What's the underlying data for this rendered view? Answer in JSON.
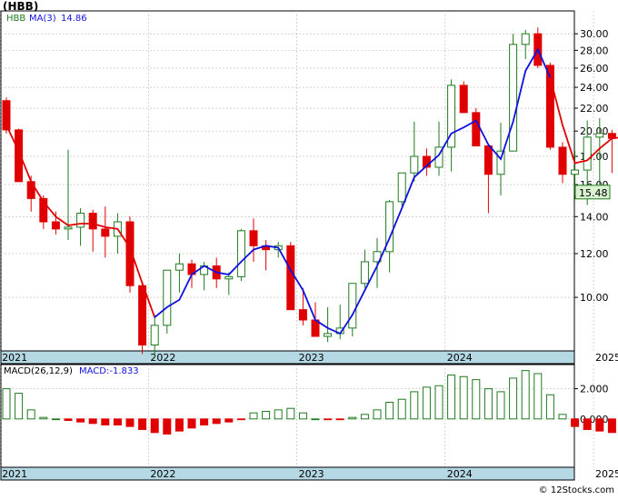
{
  "header": {
    "ticker_label": "(HBB)"
  },
  "legend": {
    "symbol": "HBB",
    "ma_label": "MA(3)",
    "ma_value": "14.86",
    "macd_label": "MACD(26,12,9)",
    "macd_value": "MACD:-1.833"
  },
  "last_price_tag": "15.48",
  "watermark": "© 12Stocks.com",
  "colors": {
    "up": "#1f7a1f",
    "down": "#e00000",
    "ma_up": "#1010e0",
    "ma_down": "#e00000",
    "axis_band": "#b4d8e4",
    "grid": "#b8b8b8"
  },
  "chart_data": [
    {
      "type": "candlestick",
      "title": "(HBB)",
      "period": "monthly",
      "y_scale": "log",
      "ylim": [
        8.0,
        33.0
      ],
      "y_ticks": [
        "10.00",
        "12.00",
        "14.00",
        "16.00",
        "18.00",
        "20.00",
        "22.00",
        "24.00",
        "26.00",
        "28.00",
        "30.00"
      ],
      "x_labels": [
        {
          "label": "2021",
          "index": 0
        },
        {
          "label": "2022",
          "index": 12
        },
        {
          "label": "2023",
          "index": 24
        },
        {
          "label": "2024",
          "index": 36
        },
        {
          "label": "2025",
          "index": 48
        }
      ],
      "ohlc": [
        [
          22.7,
          23.0,
          19.8,
          20.1
        ],
        [
          20.1,
          20.2,
          17.0,
          16.2
        ],
        [
          16.2,
          16.6,
          14.3,
          15.1
        ],
        [
          15.1,
          15.3,
          13.3,
          13.7
        ],
        [
          13.7,
          14.3,
          13.0,
          13.3
        ],
        [
          13.3,
          18.5,
          12.7,
          13.4
        ],
        [
          13.4,
          14.5,
          12.4,
          14.2
        ],
        [
          14.2,
          14.4,
          12.1,
          13.3
        ],
        [
          13.3,
          14.6,
          11.8,
          12.9
        ],
        [
          12.9,
          14.2,
          12.0,
          13.7
        ],
        [
          13.7,
          14.0,
          10.2,
          10.5
        ],
        [
          10.5,
          10.7,
          7.9,
          8.2
        ],
        [
          8.2,
          9.3,
          7.8,
          8.9
        ],
        [
          8.9,
          10.5,
          8.6,
          11.2
        ],
        [
          11.2,
          12.0,
          10.2,
          11.5
        ],
        [
          11.5,
          11.7,
          10.4,
          11.0
        ],
        [
          11.0,
          11.6,
          10.3,
          11.4
        ],
        [
          11.4,
          11.8,
          10.4,
          10.8
        ],
        [
          10.8,
          11.1,
          10.1,
          10.9
        ],
        [
          10.9,
          13.3,
          10.7,
          13.2
        ],
        [
          13.2,
          13.9,
          11.6,
          12.4
        ],
        [
          12.4,
          12.7,
          11.2,
          12.2
        ],
        [
          12.2,
          12.6,
          11.8,
          12.4
        ],
        [
          12.4,
          12.6,
          10.0,
          9.5
        ],
        [
          9.5,
          10.4,
          8.9,
          9.1
        ],
        [
          9.1,
          9.8,
          8.6,
          8.5
        ],
        [
          8.5,
          9.6,
          8.3,
          8.6
        ],
        [
          8.6,
          9.7,
          8.4,
          8.8
        ],
        [
          8.8,
          10.5,
          8.5,
          10.6
        ],
        [
          10.6,
          12.2,
          10.4,
          11.6
        ],
        [
          11.6,
          12.8,
          10.4,
          12.1
        ],
        [
          12.1,
          15.0,
          11.1,
          14.9
        ],
        [
          14.9,
          16.8,
          14.6,
          16.8
        ],
        [
          16.8,
          20.8,
          16.2,
          18.0
        ],
        [
          18.0,
          18.6,
          16.6,
          17.2
        ],
        [
          17.2,
          20.8,
          16.6,
          18.7
        ],
        [
          18.7,
          24.8,
          16.9,
          24.2
        ],
        [
          24.2,
          24.6,
          22.1,
          21.6
        ],
        [
          21.6,
          22.0,
          20.0,
          18.8
        ],
        [
          18.8,
          18.9,
          14.2,
          16.7
        ],
        [
          16.7,
          20.7,
          15.3,
          18.4
        ],
        [
          18.4,
          30.0,
          19.8,
          28.7
        ],
        [
          28.7,
          30.5,
          27.0,
          30.0
        ],
        [
          30.0,
          30.8,
          26.0,
          26.3
        ],
        [
          26.3,
          26.6,
          18.5,
          18.7
        ],
        [
          18.7,
          19.1,
          16.1,
          16.7
        ],
        [
          16.7,
          18.4,
          15.3,
          17.0
        ],
        [
          17.0,
          20.9,
          14.7,
          19.5
        ],
        [
          19.5,
          21.1,
          16.0,
          19.8
        ],
        [
          19.8,
          20.1,
          16.8,
          19.4
        ],
        [
          19.4,
          20.9,
          15.5,
          19.7
        ],
        [
          19.7,
          20.3,
          13.1,
          18.5
        ],
        [
          18.5,
          18.7,
          17.5,
          17.8
        ],
        [
          17.8,
          20.4,
          13.0,
          15.5
        ],
        [
          15.5,
          16.0,
          12.8,
          14.6
        ],
        [
          14.6,
          15.0,
          13.6,
          14.5
        ],
        [
          14.5,
          16.3,
          13.9,
          15.48
        ]
      ],
      "ma3": [
        20.5,
        18.4,
        16.2,
        14.9,
        14.0,
        13.5,
        13.6,
        13.6,
        13.4,
        13.3,
        12.3,
        10.6,
        9.2,
        9.6,
        9.9,
        11.0,
        11.4,
        11.1,
        11.0,
        11.6,
        12.2,
        12.4,
        12.3,
        11.2,
        10.3,
        9.1,
        8.8,
        8.6,
        9.3,
        10.3,
        11.4,
        12.8,
        14.5,
        16.5,
        17.3,
        18.1,
        19.8,
        20.3,
        20.9,
        18.9,
        17.8,
        20.8,
        25.7,
        28.1,
        25.0,
        20.5,
        17.5,
        17.7,
        18.6,
        19.4,
        19.5,
        18.9,
        18.1,
        17.2,
        15.9,
        14.9,
        14.86
      ],
      "ma_up_until_index": 43
    },
    {
      "type": "bar",
      "title": "MACD(26,12,9)",
      "ylim": [
        -3.2,
        3.6
      ],
      "y_ticks": [
        "0.000",
        "2.000"
      ],
      "x_labels": [
        "2021",
        "2022",
        "2023",
        "2024",
        "2025"
      ],
      "values": [
        2.0,
        1.7,
        0.6,
        0.1,
        0.0,
        -0.1,
        -0.2,
        -0.3,
        -0.4,
        -0.4,
        -0.5,
        -0.7,
        -0.9,
        -1.0,
        -0.8,
        -0.6,
        -0.4,
        -0.3,
        -0.2,
        -0.05,
        0.4,
        0.5,
        0.6,
        0.7,
        0.4,
        0.0,
        -0.05,
        -0.05,
        0.1,
        0.3,
        0.6,
        1.1,
        1.3,
        1.8,
        2.1,
        2.2,
        2.9,
        2.8,
        2.6,
        2.0,
        1.8,
        2.7,
        3.2,
        3.0,
        1.6,
        0.3,
        -0.5,
        -0.7,
        -0.8,
        -0.9,
        -1.0,
        -1.1,
        -1.2,
        -1.5,
        -1.7,
        -1.9,
        -1.833
      ]
    }
  ]
}
